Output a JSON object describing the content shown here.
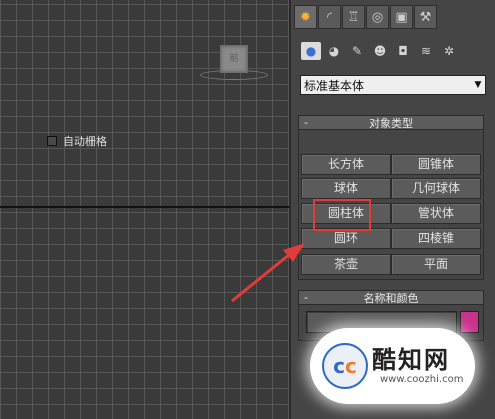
{
  "viewport": {
    "cube_label": "前"
  },
  "panel": {
    "tabs": [
      {
        "icon": "sun-create-icon",
        "glyph": "✹",
        "active": true
      },
      {
        "icon": "curve-modify-icon",
        "glyph": "◜",
        "active": false
      },
      {
        "icon": "hierarchy-icon",
        "glyph": "♖",
        "active": false
      },
      {
        "icon": "motion-icon",
        "glyph": "◎",
        "active": false
      },
      {
        "icon": "display-icon",
        "glyph": "▣",
        "active": false
      },
      {
        "icon": "hammer-utilities-icon",
        "glyph": "⚒",
        "active": false
      }
    ],
    "subtypes": [
      {
        "icon": "geometry-icon",
        "glyph": "●",
        "active": true
      },
      {
        "icon": "shapes-icon",
        "glyph": "◕",
        "active": false
      },
      {
        "icon": "lights-icon",
        "glyph": "✎",
        "active": false
      },
      {
        "icon": "cameras-icon",
        "glyph": "☻",
        "active": false
      },
      {
        "icon": "helpers-icon",
        "glyph": "◘",
        "active": false
      },
      {
        "icon": "spacewarps-icon",
        "glyph": "≋",
        "active": false
      },
      {
        "icon": "systems-icon",
        "glyph": "✲",
        "active": false
      }
    ],
    "dropdown_value": "标准基本体",
    "object_type": {
      "minus": "-",
      "title": "对象类型",
      "autogrid_label": "自动栅格",
      "buttons": [
        "长方体",
        "圆锥体",
        "球体",
        "几何球体",
        "圆柱体",
        "管状体",
        "圆环",
        "四棱锥",
        "茶壶",
        "平面"
      ]
    },
    "name_color": {
      "minus": "-",
      "title": "名称和颜色",
      "name_value": "",
      "color": "#c8328c"
    }
  },
  "annotation": {
    "highlight_color": "#e23b3b"
  },
  "watermark": {
    "logo_text_1": "c",
    "logo_text_2": "c",
    "name": "酷知网",
    "url": "www.coozhi.com"
  }
}
